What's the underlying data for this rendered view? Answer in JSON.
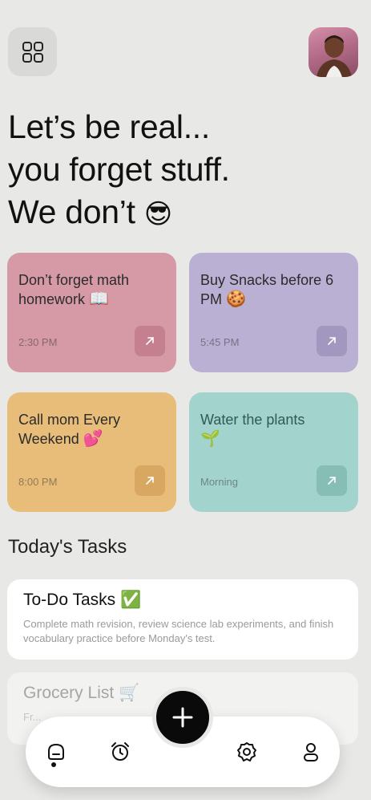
{
  "header": {
    "menu_icon": "grid-icon",
    "avatar_alt": "profile photo"
  },
  "headline": {
    "line1": "Let’s be real...",
    "line2": "you forget stuff.",
    "line3_text": "We don’t",
    "line3_emoji": "😎"
  },
  "reminders": [
    {
      "title": "Don’t forget math homework",
      "emoji": "📖",
      "time": "2:30 PM",
      "color": "#d69aa6"
    },
    {
      "title": "Buy Snacks before 6 PM",
      "emoji": "🍪",
      "time": "5:45 PM",
      "color": "#b9b0d3"
    },
    {
      "title": "Call mom Every Weekend",
      "emoji": "💕",
      "time": "8:00 PM",
      "color": "#e8bd79"
    },
    {
      "title": "Water the plants",
      "emoji": "🌱",
      "time": "Morning",
      "color": "#a3d3cd"
    }
  ],
  "tasks_section": {
    "title": "Today's Tasks",
    "items": [
      {
        "title": "To-Do Tasks ✅",
        "description": "Complete math revision, review science lab experiments, and finish vocabulary practice before Monday's test."
      },
      {
        "title": "Grocery List 🛒",
        "description": "Fr..."
      }
    ]
  },
  "nav": {
    "items": [
      "home-icon",
      "alarm-clock-icon",
      "settings-icon",
      "profile-icon"
    ],
    "fab_icon": "plus-icon"
  }
}
